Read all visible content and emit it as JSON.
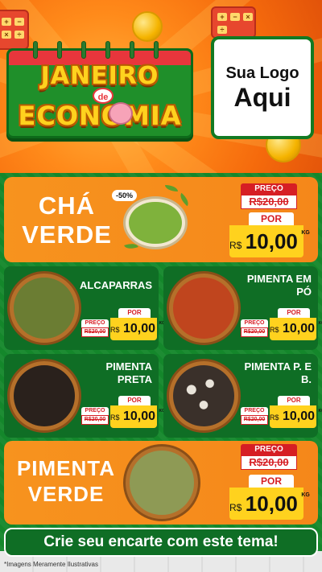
{
  "header": {
    "title_line1": "JANEIRO",
    "title_de": "de",
    "title_line2": "ECONOMIA",
    "logo_line1": "Sua Logo",
    "logo_line2": "Aqui"
  },
  "featured": [
    {
      "name": "CHÁ VERDE",
      "badge": "-50%",
      "preco_label": "PREÇO",
      "preco_old": "R$20,00",
      "por_label": "POR",
      "currency": "R$",
      "price": "10,00",
      "unit": "KG",
      "color": "#7fb23c"
    },
    {
      "name": "PIMENTA VERDE",
      "preco_label": "PREÇO",
      "preco_old": "R$20,00",
      "por_label": "POR",
      "currency": "R$",
      "price": "10,00",
      "unit": "KG",
      "color": "#8e9a55"
    }
  ],
  "products": [
    {
      "name": "ALCAPARRAS",
      "preco_label": "PREÇO",
      "preco_old": "R$20,00",
      "por_label": "POR",
      "currency": "R$",
      "price": "10,00",
      "unit": "KG",
      "color": "#6b7d33"
    },
    {
      "name": "PIMENTA EM PÓ",
      "preco_label": "PREÇO",
      "preco_old": "R$20,00",
      "por_label": "POR",
      "currency": "R$",
      "price": "10,00",
      "unit": "KG",
      "color": "#c0451e"
    },
    {
      "name": "PIMENTA PRETA",
      "preco_label": "PREÇO",
      "preco_old": "R$20,00",
      "por_label": "POR",
      "currency": "R$",
      "price": "10,00",
      "unit": "KG",
      "color": "#2a211c"
    },
    {
      "name": "PIMENTA P. E B.",
      "preco_label": "PREÇO",
      "preco_old": "R$20,00",
      "por_label": "POR",
      "currency": "R$",
      "price": "10,00",
      "unit": "KG",
      "color": "#5b5047"
    }
  ],
  "cta": "Crie seu encarte com este tema!",
  "note": "*Imagens Meramente Ilustrativas",
  "colors": {
    "orange": "#f7931e",
    "green": "#14872b",
    "red": "#d61e24",
    "yellow": "#ffd21e"
  }
}
